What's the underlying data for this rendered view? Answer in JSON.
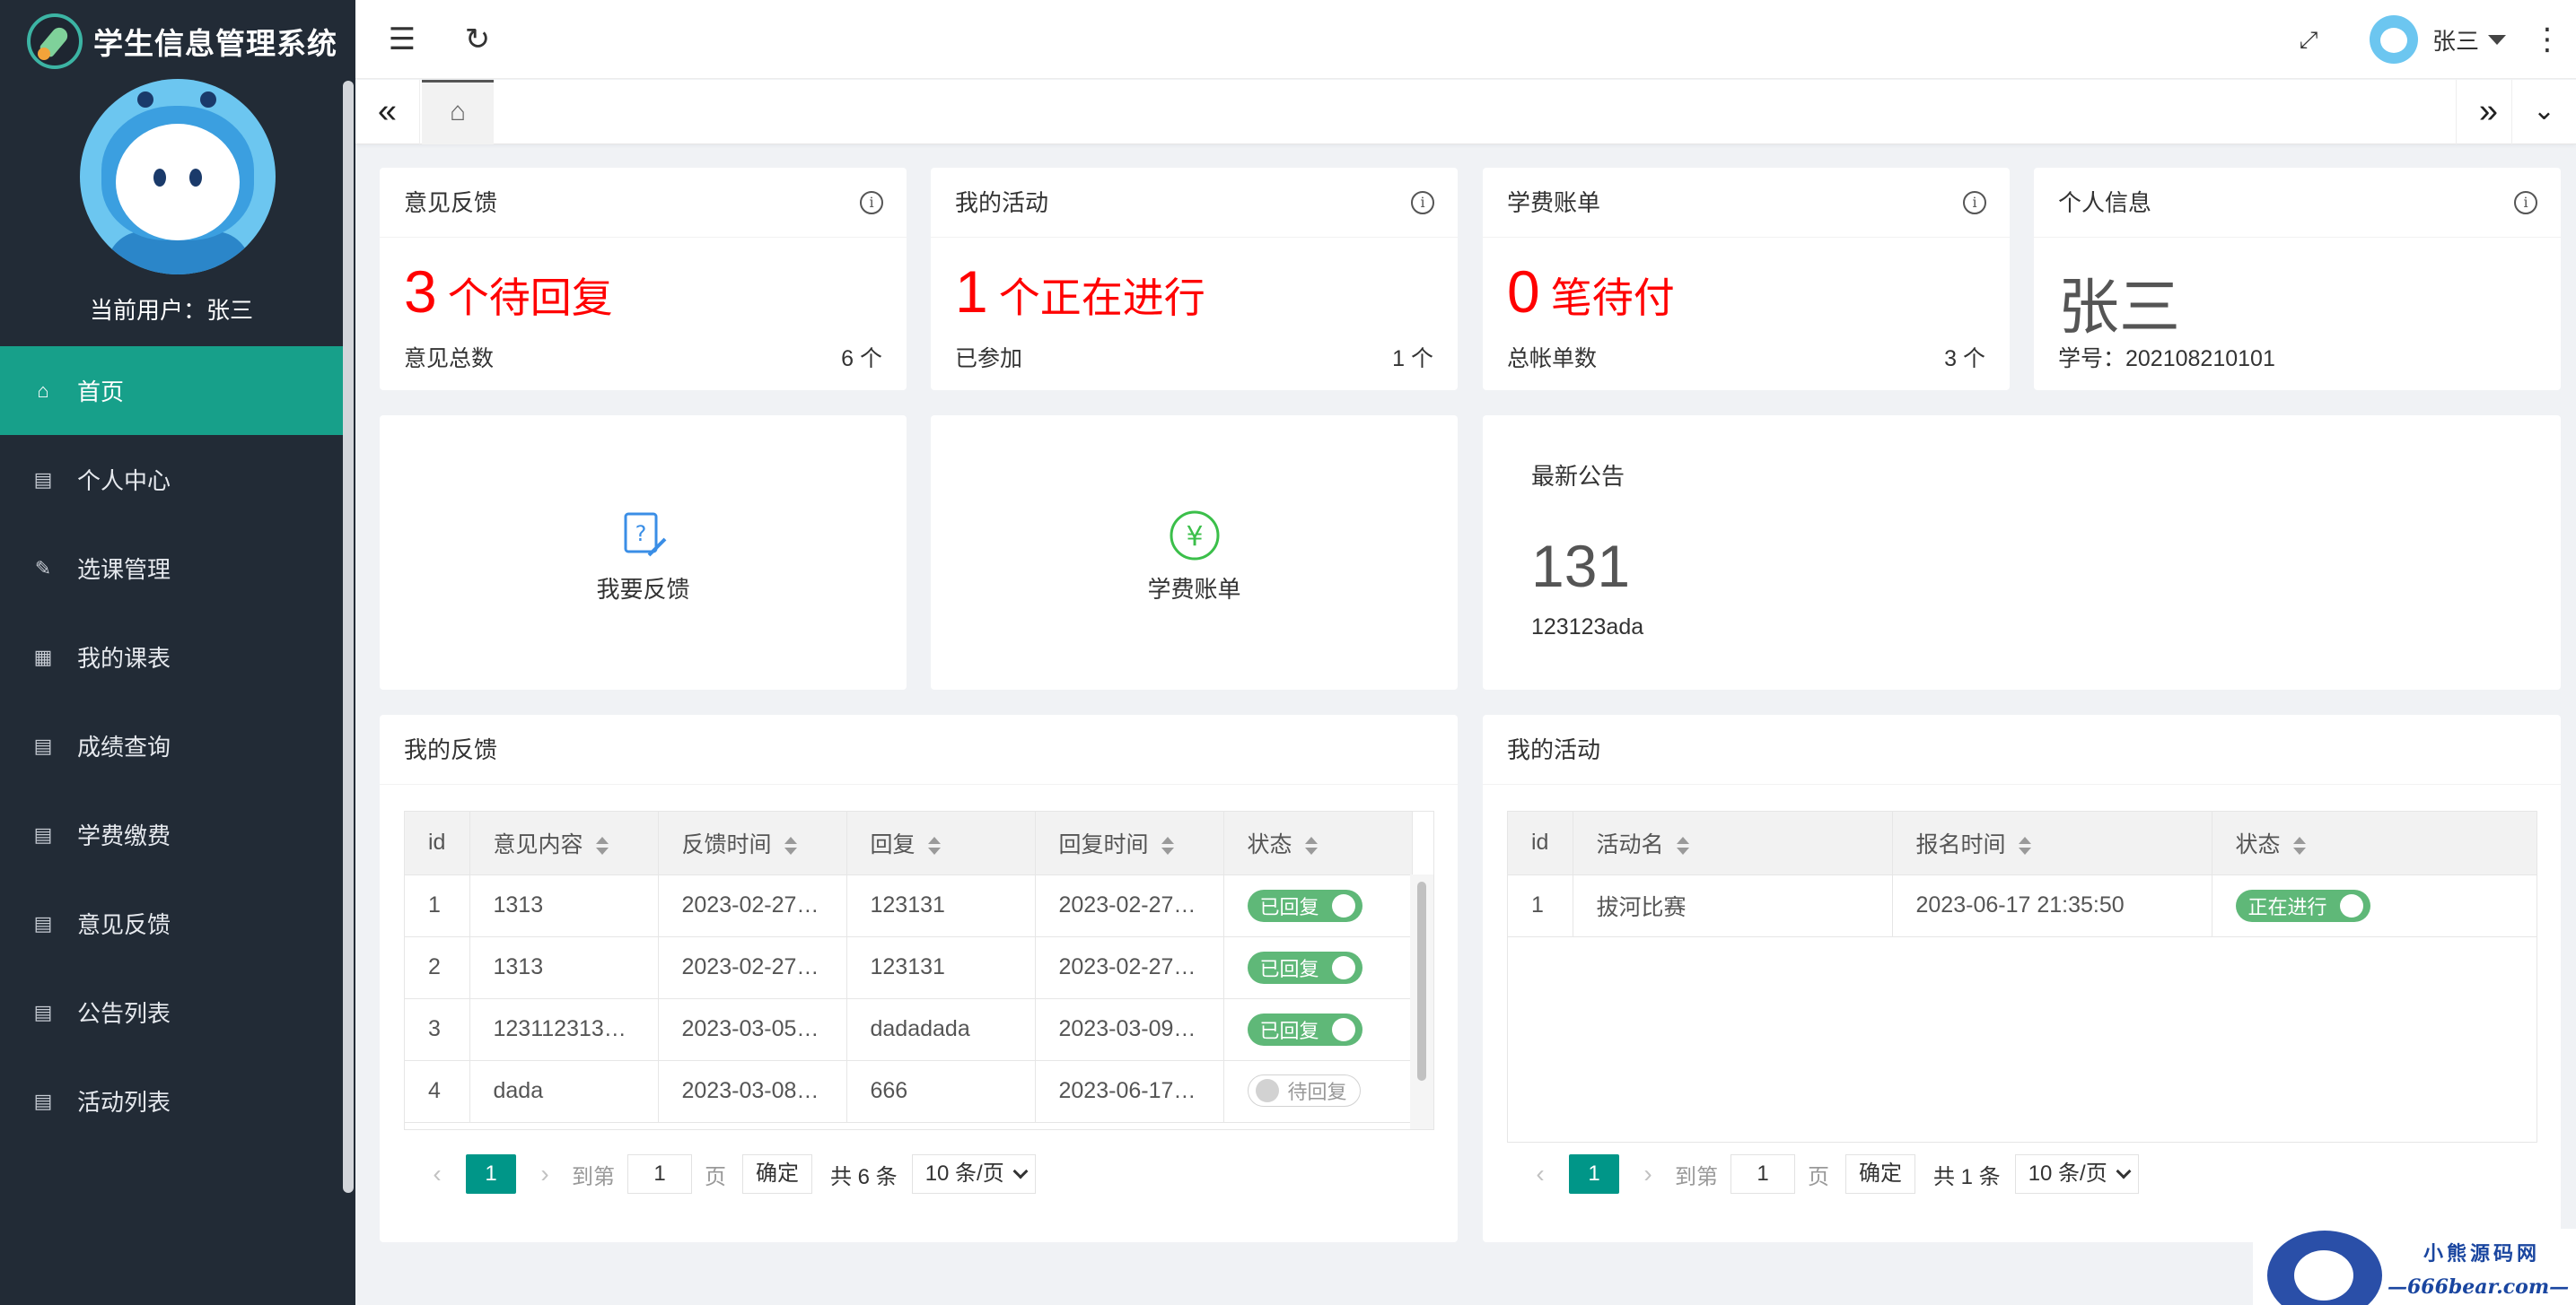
{
  "app": {
    "title": "学生信息管理系统",
    "current_user": "当前用户：张三"
  },
  "sidebar": {
    "items": [
      {
        "label": "首页",
        "icon": "home-icon",
        "active": true
      },
      {
        "label": "个人中心",
        "icon": "id-card-icon"
      },
      {
        "label": "选课管理",
        "icon": "edit-icon"
      },
      {
        "label": "我的课表",
        "icon": "grid-icon"
      },
      {
        "label": "成绩查询",
        "icon": "table-icon"
      },
      {
        "label": "学费缴费",
        "icon": "table-icon"
      },
      {
        "label": "意见反馈",
        "icon": "table-icon"
      },
      {
        "label": "公告列表",
        "icon": "table-icon"
      },
      {
        "label": "活动列表",
        "icon": "table-icon"
      }
    ]
  },
  "header": {
    "user_name": "张三"
  },
  "stats": [
    {
      "title": "意见反馈",
      "num": "3",
      "text": "个待回复",
      "label": "意见总数",
      "value": "6 个"
    },
    {
      "title": "我的活动",
      "num": "1",
      "text": "个正在进行",
      "label": "已参加",
      "value": "1 个"
    },
    {
      "title": "学费账单",
      "num": "0",
      "text": "笔待付",
      "label": "总帐单数",
      "value": "3 个"
    }
  ],
  "profile": {
    "title": "个人信息",
    "name": "张三",
    "student_no": "学号：202108210101"
  },
  "quick": {
    "feedback": "我要反馈",
    "tuition": "学费账单"
  },
  "notice": {
    "title": "最新公告",
    "num": "131",
    "text": "123123ada"
  },
  "feedback_table": {
    "title": "我的反馈",
    "columns": [
      "id",
      "意见内容",
      "反馈时间",
      "回复",
      "回复时间",
      "状态"
    ],
    "rows": [
      {
        "id": "1",
        "content": "1313",
        "time": "2023-02-27…",
        "reply": "123131",
        "reply_time": "2023-02-27…",
        "status": "已回复",
        "on": true
      },
      {
        "id": "2",
        "content": "1313",
        "time": "2023-02-27…",
        "reply": "123131",
        "reply_time": "2023-02-27…",
        "status": "已回复",
        "on": true
      },
      {
        "id": "3",
        "content": "123112313…",
        "time": "2023-03-05…",
        "reply": "dadadada",
        "reply_time": "2023-03-09…",
        "status": "已回复",
        "on": true
      },
      {
        "id": "4",
        "content": "dada",
        "time": "2023-03-08…",
        "reply": "666",
        "reply_time": "2023-06-17…",
        "status": "待回复",
        "on": false
      }
    ],
    "pager": {
      "current": "1",
      "goto": "到第",
      "page_value": "1",
      "page_word": "页",
      "confirm": "确定",
      "total": "共 6 条",
      "size": "10 条/页"
    }
  },
  "activity_table": {
    "title": "我的活动",
    "columns": [
      "id",
      "活动名",
      "报名时间",
      "状态"
    ],
    "rows": [
      {
        "id": "1",
        "name": "拔河比赛",
        "time": "2023-06-17 21:35:50",
        "status": "正在进行",
        "on": true
      }
    ],
    "pager": {
      "current": "1",
      "goto": "到第",
      "page_value": "1",
      "page_word": "页",
      "confirm": "确定",
      "total": "共 1 条",
      "size": "10 条/页"
    }
  },
  "watermark": {
    "line1": "小熊源码网",
    "line2": "—666bear.com—"
  },
  "colors": {
    "sidebar_bg": "#222b36",
    "active": "#17a08a",
    "accent_red": "#ff0000",
    "switch_on": "#5fb878",
    "pager": "#009688"
  }
}
